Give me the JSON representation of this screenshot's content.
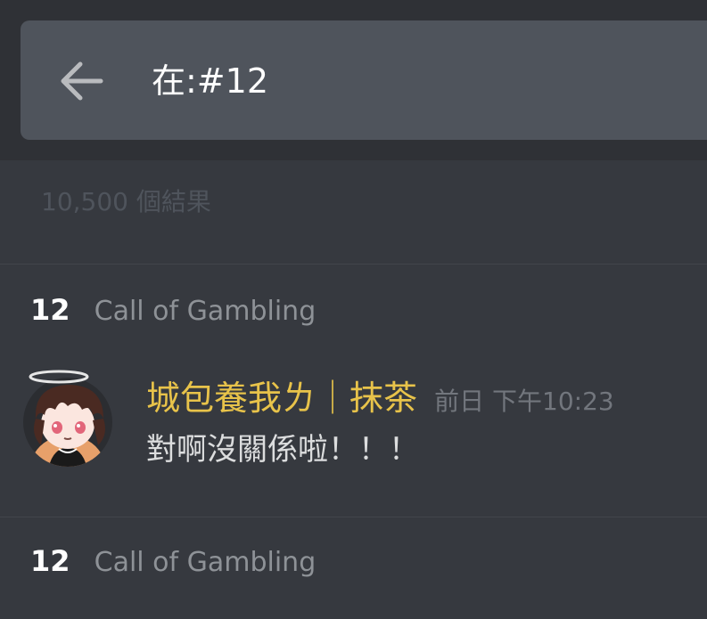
{
  "search": {
    "query": "在:#12"
  },
  "results": {
    "count_label": "10,500 個結果",
    "groups": [
      {
        "channel": "12",
        "guild": "Call of Gambling",
        "message": {
          "author": "城包養我ㄌ｜抹茶",
          "timestamp": "前日 下午10:23",
          "content": "對啊沒關係啦！！！",
          "author_color": "#e8c34a"
        }
      },
      {
        "channel": "12",
        "guild": "Call of Gambling"
      }
    ]
  },
  "colors": {
    "background": "#36393f",
    "header_background": "#2f3136",
    "search_box": "#4f545c"
  }
}
